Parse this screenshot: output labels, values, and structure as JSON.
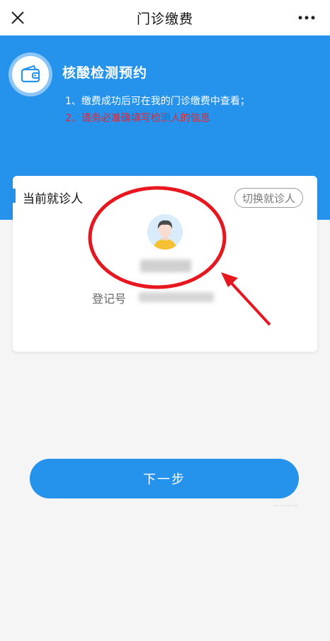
{
  "navbar": {
    "title": "门诊缴费",
    "close_icon": "close-icon",
    "more_icon": "more-icon"
  },
  "hero": {
    "icon": "wallet-icon",
    "title": "核酸检测预约",
    "note1": "1、缴费成功后可在我的门诊缴费中查看；",
    "note2": "2、请务必准确填写检测人的信息",
    "note2_color": "#e8242f",
    "background": "#2592ec"
  },
  "patient_card": {
    "title": "当前就诊人",
    "switch_label": "切换就诊人",
    "avatar_icon": "avatar-icon",
    "reg_label": "登记号"
  },
  "actions": {
    "next_label": "下一步"
  },
  "annotation": {
    "circle_color": "#e8161e",
    "arrow_color": "#e8161e"
  }
}
